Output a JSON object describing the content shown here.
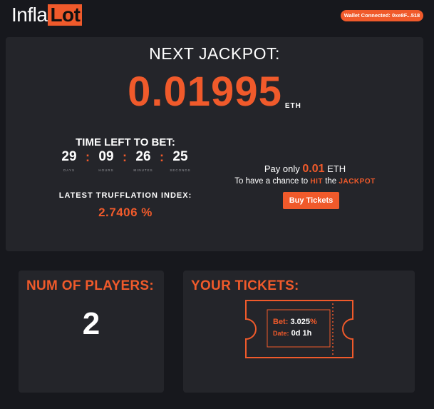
{
  "header": {
    "logo_part1": "Infla",
    "logo_part2": "Lot",
    "wallet_label": "Wallet Connected: 0xe8F...518"
  },
  "jackpot": {
    "title": "NEXT JACKPOT:",
    "value": "0.01995",
    "unit": "ETH"
  },
  "timer": {
    "title": "TIME LEFT TO BET:",
    "days": "29",
    "hours": "09",
    "minutes": "26",
    "seconds": "25",
    "days_label": "DAYS",
    "hours_label": "HOURS",
    "minutes_label": "MINUTES",
    "seconds_label": "SECONDS",
    "separator": ":"
  },
  "trufflation": {
    "title": "LATEST TRUFFLATION INDEX:",
    "value": "2.7406 %"
  },
  "buy": {
    "pay_prefix": "Pay only",
    "pay_amount": "0.01",
    "pay_unit": "ETH",
    "chance_prefix": "To have a chance to",
    "chance_hit": "HIT",
    "chance_the": "the",
    "chance_jackpot": "JACKPOT",
    "button_label": "Buy Tickets"
  },
  "players": {
    "title": "NUM OF PLAYERS:",
    "count": "2"
  },
  "tickets": {
    "title": "YOUR TICKETS:",
    "bet_label": "Bet:",
    "bet_value": "3.025",
    "bet_unit": "%",
    "date_label": "Date:",
    "date_value": "0d 1h"
  },
  "colors": {
    "accent": "#f05a2b",
    "background": "#17181d",
    "panel": "#24252a"
  }
}
